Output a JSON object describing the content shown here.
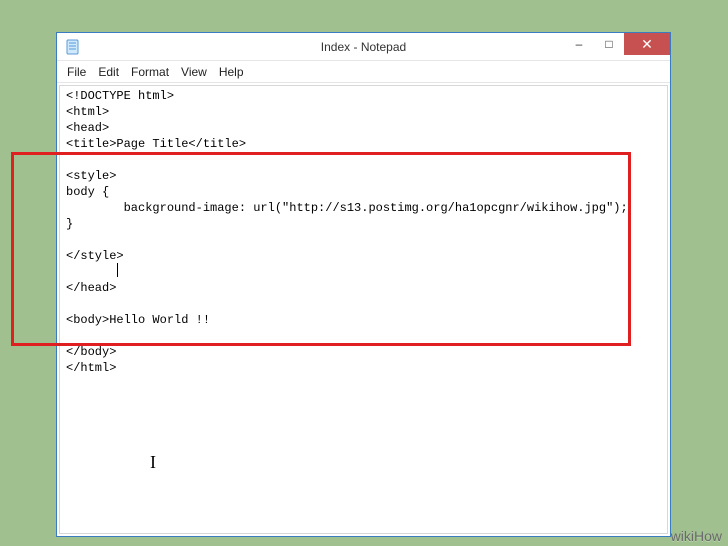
{
  "window": {
    "title": "Index - Notepad"
  },
  "winControls": {
    "minimize": "–",
    "maximize": "□",
    "close": "✕"
  },
  "menubar": {
    "file": "File",
    "edit": "Edit",
    "format": "Format",
    "view": "View",
    "help": "Help"
  },
  "editor": {
    "content": "<!DOCTYPE html>\n<html>\n<head>\n<title>Page Title</title>\n\n<style>\nbody {\n        background-image: url(\"http://s13.postimg.org/ha1opcgnr/wikihow.jpg\");\n}\n\n</style>\n\n</head>\n\n<body>Hello World !!\n\n</body>\n</html>"
  },
  "watermark": "wikiHow"
}
